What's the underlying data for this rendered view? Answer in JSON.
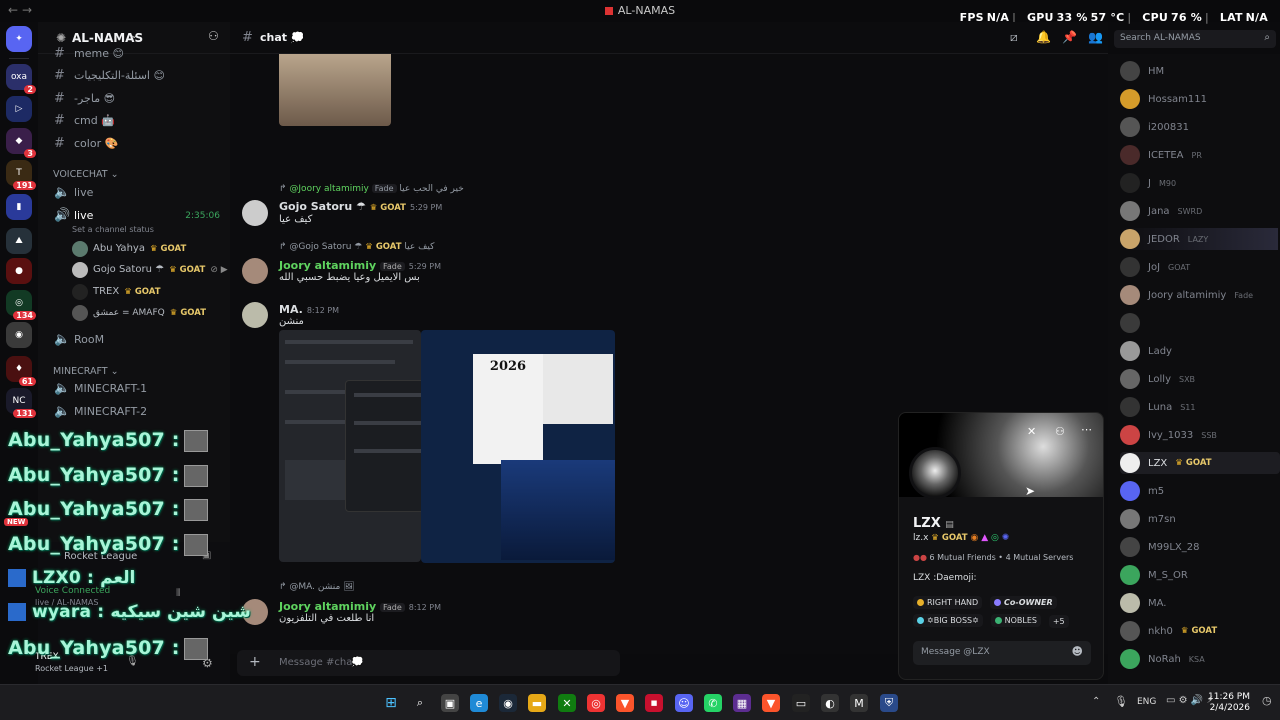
{
  "window": {
    "title": "AL-NAMAS",
    "back_arrow": "←",
    "forward_arrow": "→"
  },
  "overlay_stats": {
    "fps_label": "FPS",
    "fps_value": "N/A",
    "gpu_label": "GPU",
    "gpu_value": "33 %",
    "gpu_temp": "57 °C",
    "cpu_label": "CPU",
    "cpu_value": "76 %",
    "lat_label": "LAT",
    "lat_value": "N/A"
  },
  "rail": {
    "badges": [
      "2",
      "3",
      "191",
      "134",
      "61",
      "131"
    ],
    "new_label": "NEW"
  },
  "server": {
    "name": "AL-NAMAS"
  },
  "channels": {
    "text": [
      {
        "name": "meme"
      },
      {
        "name": "اسئلة-التكليجيات"
      },
      {
        "name": "-ماجر"
      },
      {
        "name": "cmd"
      },
      {
        "name": "color"
      }
    ],
    "voicechat_category": "VOICECHAT",
    "voice": [
      {
        "name": "live"
      },
      {
        "name": "live",
        "timer": "2:35:06",
        "status_hint": "Set a channel status"
      }
    ],
    "voice_users": [
      {
        "name": "Abu Yahya",
        "tag": "GOAT"
      },
      {
        "name": "Gojo Satoru ☂",
        "tag": "GOAT"
      },
      {
        "name": "TREX",
        "tag": "GOAT"
      },
      {
        "name": "عمشق = AMAFQ",
        "tag": "GOAT"
      }
    ],
    "room": "RooM",
    "minecraft_category": "MINECRAFT",
    "minecraft": [
      {
        "name": "MINECRAFT-1"
      },
      {
        "name": "MINECRAFT-2"
      }
    ]
  },
  "activity": {
    "game": "Rocket League",
    "voice_connected": "Voice Connected",
    "voice_location": "live / AL-NAMAS",
    "user": "TREX",
    "user_status": "Rocket League +1"
  },
  "stream_overlay": [
    {
      "text": "Abu_Yahya507 :"
    },
    {
      "text": "Abu_Yahya507 :"
    },
    {
      "text": "Abu_Yahya507 :"
    },
    {
      "text": "Abu_Yahya507 :"
    },
    {
      "text": "LZX0 : العم"
    },
    {
      "text": "wyara : شين شين سيكيه"
    },
    {
      "text": "Abu_Yahya507 :"
    }
  ],
  "chat": {
    "channel": "chat",
    "search_placeholder": "Search AL-NAMAS",
    "composer_placeholder": "Message #chat",
    "messages": [
      {
        "reply_to": "@Joory altamimiy",
        "reply_tag": "Fade",
        "reply_text": "خير في الحب عيا",
        "author": "Gojo Satoru ☂",
        "tag": "GOAT",
        "time": "5:29 PM",
        "text": "كيف عيا",
        "color": "#dbdee1"
      },
      {
        "reply_to": "@Gojo Satoru ☂",
        "reply_tag": "GOAT",
        "reply_text": "كيف عيا",
        "author": "Joory altamimiy",
        "tag": "Fade",
        "time": "5:29 PM",
        "text": "بس الايميل وعيا يضبط حسبي الله",
        "color": "#5fd35f"
      },
      {
        "author": "MA.",
        "time": "8:12 PM",
        "text": "منشن",
        "color": "#dbdee1"
      },
      {
        "reply_to": "@MA.",
        "reply_text": "منشن",
        "author": "Joory altamimiy",
        "tag": "Fade",
        "time": "8:12 PM",
        "text": "انا طلعت في التلفزيون",
        "color": "#5fd35f"
      }
    ],
    "embed_year": "2026"
  },
  "members": [
    {
      "name": "HM"
    },
    {
      "name": "Hossam111"
    },
    {
      "name": "i200831"
    },
    {
      "name": "ICETEA",
      "tag": "PR"
    },
    {
      "name": "J",
      "tag": "M90"
    },
    {
      "name": "Jana",
      "tag": "SWRD"
    },
    {
      "name": "JEDOR",
      "tag": "LAZY"
    },
    {
      "name": "JoJ",
      "tag": "GOAT"
    },
    {
      "name": "Joory altamimiy",
      "tag": "Fade"
    },
    {
      "name": ""
    },
    {
      "name": "Lady"
    },
    {
      "name": "Lolly",
      "tag": "SXB"
    },
    {
      "name": "Luna",
      "tag": "S11"
    },
    {
      "name": "Ivy_1033",
      "tag": "SSB"
    },
    {
      "name": "LZX",
      "tag": "GOAT"
    },
    {
      "name": "m5"
    },
    {
      "name": "m7sn"
    },
    {
      "name": "M99LX_28"
    },
    {
      "name": "M_S_OR"
    },
    {
      "name": "MA."
    },
    {
      "name": "nkh0",
      "tag": "GOAT"
    },
    {
      "name": "NoRah",
      "tag": "KSA"
    }
  ],
  "profile": {
    "display_name": "LZX",
    "username": "lz.x",
    "tag": "GOAT",
    "mutual_friends": "6 Mutual Friends",
    "mutual_servers": "4 Mutual Servers",
    "bio": "LZX :Daemoji:",
    "roles": [
      {
        "name": "RIGHT HAND",
        "color": "#e7b02a"
      },
      {
        "name": "Co-OWNER",
        "color": "#8a7cff"
      },
      {
        "name": "✡BIG BOSS✡",
        "color": "#5ad1e6"
      },
      {
        "name": "NOBLES",
        "color": "#3bb273"
      }
    ],
    "more_roles": "+5",
    "message_placeholder": "Message @LZX"
  },
  "taskbar": {
    "lang": "ENG",
    "time": "11:26 PM",
    "date": "2/4/2026"
  },
  "colors": {
    "accent": "#5865f2",
    "goat_tag": "#e7c86a",
    "overlay_text": "#a8f5d8"
  }
}
